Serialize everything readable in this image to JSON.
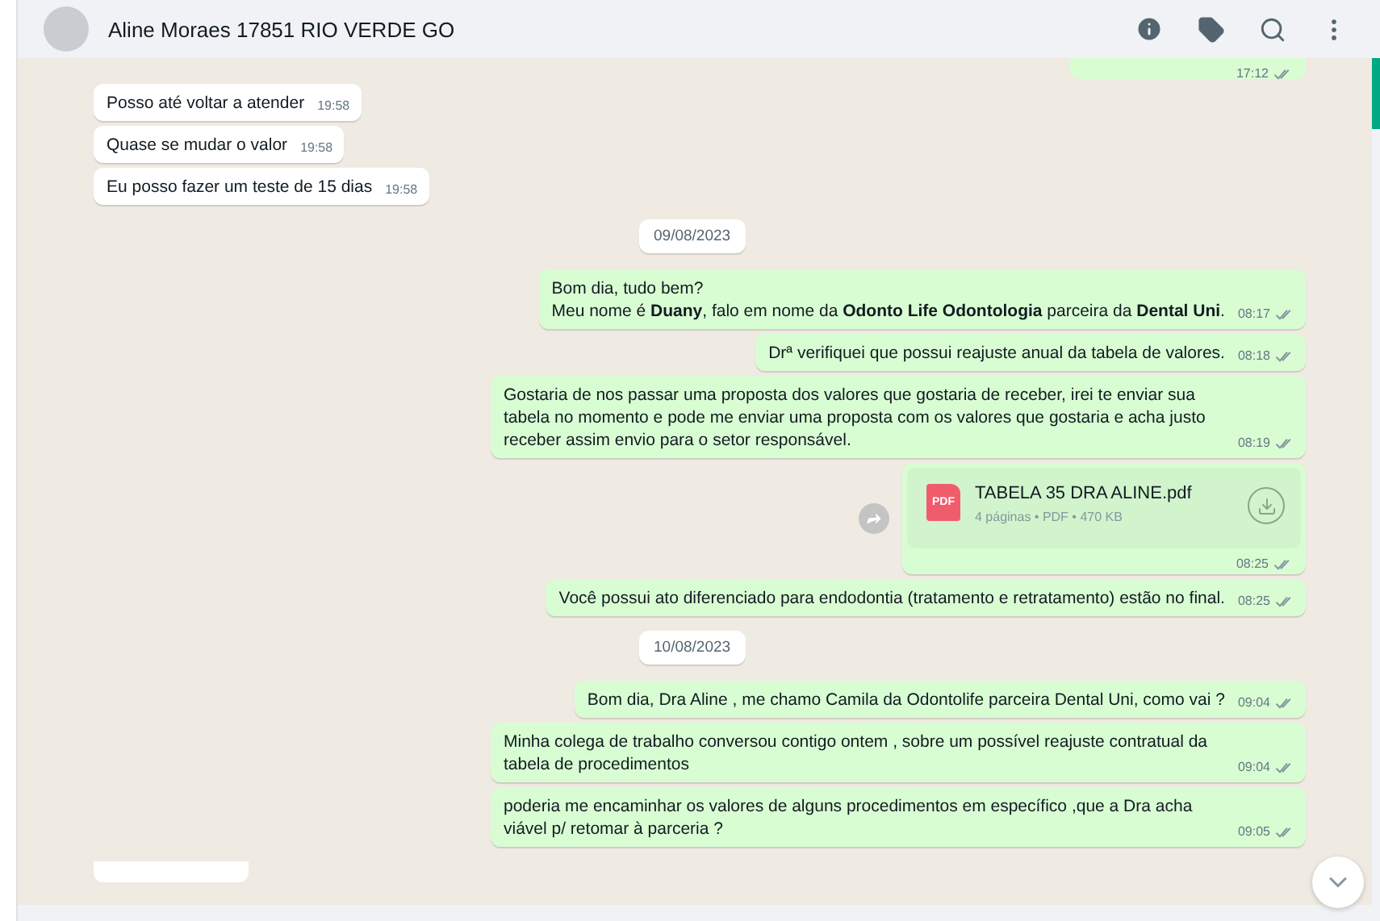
{
  "header": {
    "contact_name": "Aline Moraes 17851 RIO VERDE GO"
  },
  "messages": [
    {
      "kind": "outgoing_cut",
      "time": "17:12"
    },
    {
      "kind": "incoming",
      "text": "Posso até voltar a atender",
      "time": "19:58"
    },
    {
      "kind": "incoming",
      "text": "Quase se mudar o valor",
      "time": "19:58"
    },
    {
      "kind": "incoming",
      "text": "Eu posso fazer um teste de 15 dias",
      "time": "19:58"
    },
    {
      "kind": "date",
      "text": "09/08/2023"
    },
    {
      "kind": "outgoing",
      "text": "Bom dia, tudo bem?\nMeu nome é **Duany**, falo em nome da **Odonto Life Odontologia** parceira da **Dental Uni**.",
      "time": "08:17"
    },
    {
      "kind": "outgoing",
      "text": "Drª verifiquei que possui reajuste anual da tabela de valores.",
      "time": "08:18"
    },
    {
      "kind": "outgoing",
      "text": "Gostaria de nos passar uma proposta dos valores que gostaria de receber, irei te enviar sua tabela no momento e pode me enviar uma proposta com os valores que gostaria e acha justo receber assim envio para o setor responsável.",
      "time": "08:19"
    },
    {
      "kind": "file",
      "text": "TABELA 35 DRA ALINE.pdf",
      "file_type": "PDF",
      "meta": "4 páginas • PDF • 470 KB",
      "time": "08:25"
    },
    {
      "kind": "outgoing",
      "text": "Você possui ato diferenciado para endodontia (tratamento e retratamento) estão no final.",
      "time": "08:25"
    },
    {
      "kind": "date",
      "text": "10/08/2023"
    },
    {
      "kind": "outgoing",
      "text": "Bom dia, Dra Aline , me chamo Camila da Odontolife parceira Dental Uni, como vai ?",
      "time": "09:04"
    },
    {
      "kind": "outgoing",
      "text": "Minha colega de trabalho conversou contigo ontem , sobre um possível reajuste contratual da tabela de procedimentos",
      "time": "09:04"
    },
    {
      "kind": "outgoing",
      "text": "poderia me encaminhar os valores de alguns procedimentos em específico ,que a Dra acha viável p/ retomar à parceria ?",
      "time": "09:05"
    },
    {
      "kind": "incoming_cut"
    }
  ]
}
